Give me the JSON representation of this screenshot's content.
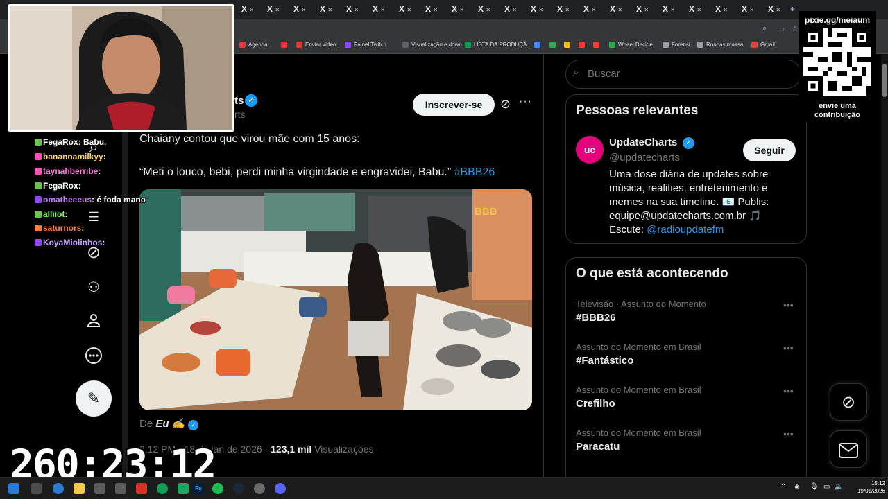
{
  "browser": {
    "tab_close_glyph": "X",
    "new_tab_glyph": "+",
    "bookmarks": [
      {
        "label": "Agenda",
        "color": "#e53935"
      },
      {
        "label": "",
        "color": "#e53935"
      },
      {
        "label": "Enviar vídeo",
        "color": "#e53935"
      },
      {
        "label": "Painel Twitch",
        "color": "#9146ff"
      },
      {
        "label": "Visualização e down...",
        "color": "#5f6368"
      },
      {
        "label": "LISTA DA PRODUÇÃ...",
        "color": "#0f9d58"
      },
      {
        "label": "",
        "color": "#4285f4"
      },
      {
        "label": "",
        "color": "#34a853"
      },
      {
        "label": "",
        "color": "#fbbc05"
      },
      {
        "label": "",
        "color": "#ea4335"
      },
      {
        "label": "",
        "color": "#ea4335"
      },
      {
        "label": "Wheel Decide",
        "color": "#34a853"
      },
      {
        "label": "Forensi",
        "color": "#9aa0a6"
      },
      {
        "label": "Roupas massa",
        "color": "#9aa0a6"
      },
      {
        "label": "Gmail",
        "color": "#ea4335"
      }
    ]
  },
  "post": {
    "author_fragment": "ts",
    "handle_fragment": "rts",
    "subscribe_label": "Inscrever-se",
    "line1": "Chaiany contou que virou mãe com 15 anos:",
    "line2_text": "“Meti o louco, bebi, perdi minha virgindade e engravidei, Babu.” ",
    "line2_hashtag": "#BBB26",
    "media_badge": "BBB",
    "byline_prefix": "De ",
    "byline_name": "Eu ✍️",
    "meta_time": "3:12 PM · 18 de jan de 2026 · ",
    "meta_views": "123,1 mil",
    "meta_views_label": " Visualizações"
  },
  "search": {
    "placeholder": "Buscar"
  },
  "relevant": {
    "title": "Pessoas relevantes",
    "avatar_text": "uc",
    "name": "UpdateCharts",
    "handle": "@updatecharts",
    "follow_label": "Seguir",
    "bio": "Uma dose diária de updates sobre música, realities, entretenimento e memes na sua timeline. 📧 Publis: equipe@updatecharts.com.br 🎵 Escute: ",
    "bio_link": "@radioupdatefm"
  },
  "trends": {
    "title": "O que está acontecendo",
    "items": [
      {
        "context": "Televisão · Assunto do Momento",
        "name": "#BBB26"
      },
      {
        "context": "Assunto do Momento em Brasil",
        "name": "#Fantástico"
      },
      {
        "context": "Assunto do Momento em Brasil",
        "name": "Crefilho"
      },
      {
        "context": "Assunto do Momento em Brasil",
        "name": "Paracatu"
      }
    ]
  },
  "chat": [
    {
      "user": "FegaRox",
      "message": ": Babu.",
      "color": "#ffffff"
    },
    {
      "user": "banannamilkyy",
      "message": ":",
      "color": "#ffd84a"
    },
    {
      "user": "taynahberribe",
      "message": ":",
      "color": "#ff7ad9"
    },
    {
      "user": "FegaRox",
      "message": ":",
      "color": "#ffffff"
    },
    {
      "user": "omatheeeus",
      "message": ": é foda mano",
      "color": "#c47bff"
    },
    {
      "user": "alliiot",
      "message": ":",
      "color": "#7cff5a"
    },
    {
      "user": "saturnors",
      "message": ":",
      "color": "#ff7a3d"
    },
    {
      "user": "KoyaMiolinhos",
      "message": ":",
      "color": "#c9a6ff"
    }
  ],
  "overlay": {
    "qr_url": "pixie.gg/meiaum",
    "qr_caption": "envie uma contribuição",
    "timer": "260:23:12"
  },
  "taskbar": {
    "time": "15:12",
    "date": "19/01/2026"
  }
}
